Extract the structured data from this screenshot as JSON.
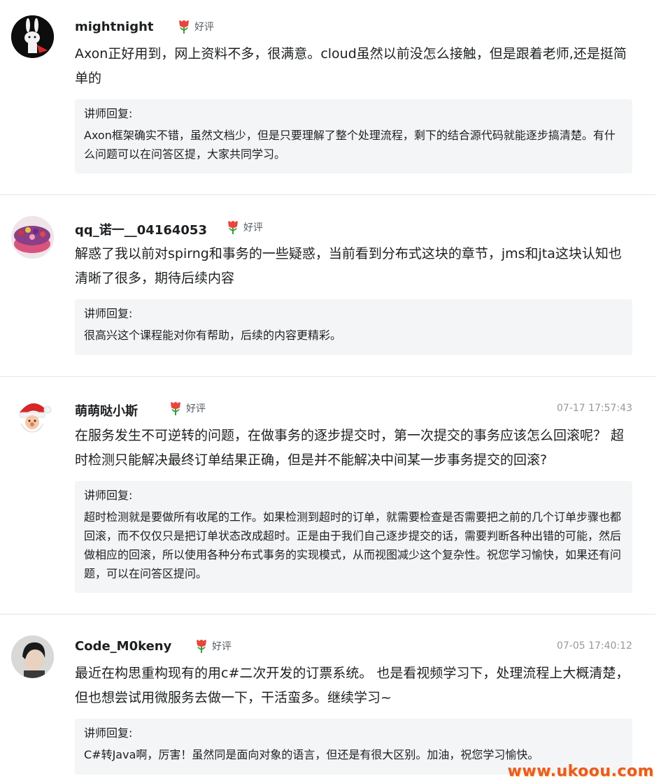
{
  "reviews": [
    {
      "username": "mightnight",
      "badge": "好评",
      "time": "",
      "content": "Axon正好用到，网上资料不多，很满意。cloud虽然以前没怎么接触，但是跟着老师,还是挺简单的",
      "reply_title": "讲师回复:",
      "reply_text": "Axon框架确实不错，虽然文档少，但是只要理解了整个处理流程，剩下的结合源代码就能逐步搞清楚。有什么问题可以在问答区提，大家共同学习。",
      "avatar": "bunny-avatar-icon"
    },
    {
      "username": "qq_诺一__04164053",
      "badge": "好评",
      "time": "",
      "content": "解惑了我以前对spirng和事务的一些疑惑，当前看到分布式这块的章节，jms和jta这块认知也清晰了很多，期待后续内容",
      "reply_title": "讲师回复:",
      "reply_text": "很高兴这个课程能对你有帮助，后续的内容更精彩。",
      "avatar": "cake-avatar-icon"
    },
    {
      "username": "萌萌哒小斯",
      "badge": "好评",
      "time": "07-17 17:57:43",
      "content": "在服务发生不可逆转的问题，在做事务的逐步提交时，第一次提交的事务应该怎么回滚呢？ 超时检测只能解决最终订单结果正确，但是并不能解决中间某一步事务提交的回滚?",
      "reply_title": "讲师回复:",
      "reply_text": "超时检测就是要做所有收尾的工作。如果检测到超时的订单，就需要检查是否需要把之前的几个订单步骤也都回滚，而不仅仅只是把订单状态改成超时。正是由于我们自己逐步提交的话，需要判断各种出错的可能，然后做相应的回滚，所以使用各种分布式事务的实现模式，从而视图减少这个复杂性。祝您学习愉快，如果还有问题，可以在问答区提问。",
      "avatar": "santa-avatar-icon"
    },
    {
      "username": "Code_M0keny",
      "badge": "好评",
      "time": "07-05 17:40:12",
      "content": "最近在构思重构现有的用c#二次开发的订票系统。 也是看视频学习下，处理流程上大概清楚， 但也想尝试用微服务去做一下，干活蛮多。继续学习~",
      "reply_title": "讲师回复:",
      "reply_text": "C#转Java啊，厉害！虽然同是面向对象的语言，但还是有很大区别。加油，祝您学习愉快。",
      "avatar": "person-avatar-icon"
    }
  ],
  "watermark": "www.ukoou.com",
  "colors": {
    "badge_flower": "#e8453c",
    "reply_bg": "#f3f5f6",
    "time": "#93999f",
    "watermark": "#e85a2a"
  }
}
